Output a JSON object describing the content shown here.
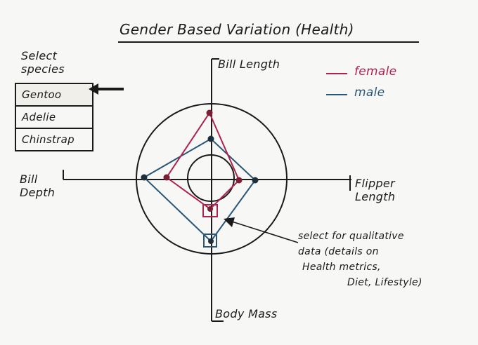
{
  "title": "Gender Based Variation (Health)",
  "species_selector": {
    "label_lines": [
      "Select",
      "species"
    ],
    "options": [
      "Gentoo",
      "Adelie",
      "Chinstrap"
    ],
    "selected": "Gentoo"
  },
  "legend": [
    {
      "label": "female",
      "color": "#b0224e"
    },
    {
      "label": "male",
      "color": "#2a5678"
    }
  ],
  "axes": {
    "top": "Bill Length",
    "right_lines": [
      "Flipper",
      "Length"
    ],
    "bottom": "Body Mass",
    "left_lines": [
      "Bill",
      "Depth"
    ]
  },
  "annotation_lines": [
    "select for qualitative",
    "data (details on",
    "Health metrics,",
    "Diet, Lifestyle)"
  ],
  "colors": {
    "ink": "#1a1a1a",
    "female": "#b0224e",
    "male": "#2a5678",
    "paper": "#f7f7f5"
  }
}
